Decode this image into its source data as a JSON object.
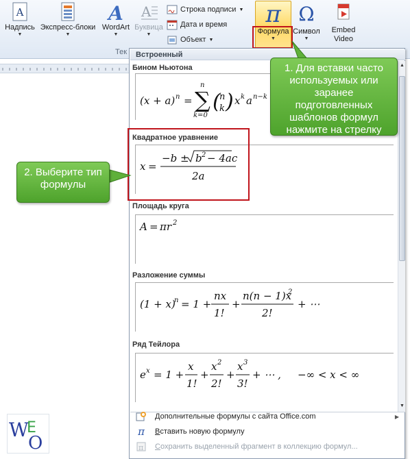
{
  "ribbon": {
    "buttons": [
      {
        "label": "Надпись",
        "icon": "text-box-icon"
      },
      {
        "label": "Экспресс-блоки",
        "icon": "quick-parts-icon"
      },
      {
        "label": "WordArt",
        "icon": "wordart-icon"
      },
      {
        "label": "Буквица",
        "icon": "drop-cap-icon",
        "disabled": true
      }
    ],
    "small_buttons": [
      {
        "label": "Строка подписи",
        "icon": "signature-line-icon"
      },
      {
        "label": "Дата и время",
        "icon": "date-time-icon"
      },
      {
        "label": "Объект",
        "icon": "object-icon"
      }
    ],
    "group_label": "Тек",
    "formula": {
      "label": "Формула",
      "icon": "pi-icon"
    },
    "symbol": {
      "label": "Символ",
      "icon": "omega-icon"
    },
    "embed": {
      "label_1": "Embed",
      "label_2": "Video",
      "icon": "embed-video-icon"
    }
  },
  "gallery": {
    "header": "Встроенный",
    "equations": [
      {
        "title": "Бином Ньютона"
      },
      {
        "title": "Квадратное уравнение"
      },
      {
        "title": "Площадь круга"
      },
      {
        "title": "Разложение суммы"
      },
      {
        "title": "Ряд Тейлора"
      }
    ],
    "menu": [
      {
        "label": "Дополнительные формулы с сайта Office.com",
        "icon": "office-formulas-icon",
        "underline": "Д",
        "rest": "ополнительные формулы с сайта Office.com"
      },
      {
        "label": "Вставить новую формулу",
        "icon": "pi-icon",
        "underline": "В",
        "rest": "ставить новую формулу"
      },
      {
        "label": "Сохранить выделенный фрагмент в коллекцию формул...",
        "icon": "save-selection-icon",
        "underline": "С",
        "rest": "охранить выделенный фрагмент в коллекцию формул...",
        "disabled": true
      }
    ]
  },
  "callouts": {
    "step1": "1. Для вставки часто используемых или заранее подготовленных шаблонов формул нажмите на стрелку",
    "step2": "2. Выберите тип формулы"
  },
  "logo": {
    "letters": "WEO"
  }
}
